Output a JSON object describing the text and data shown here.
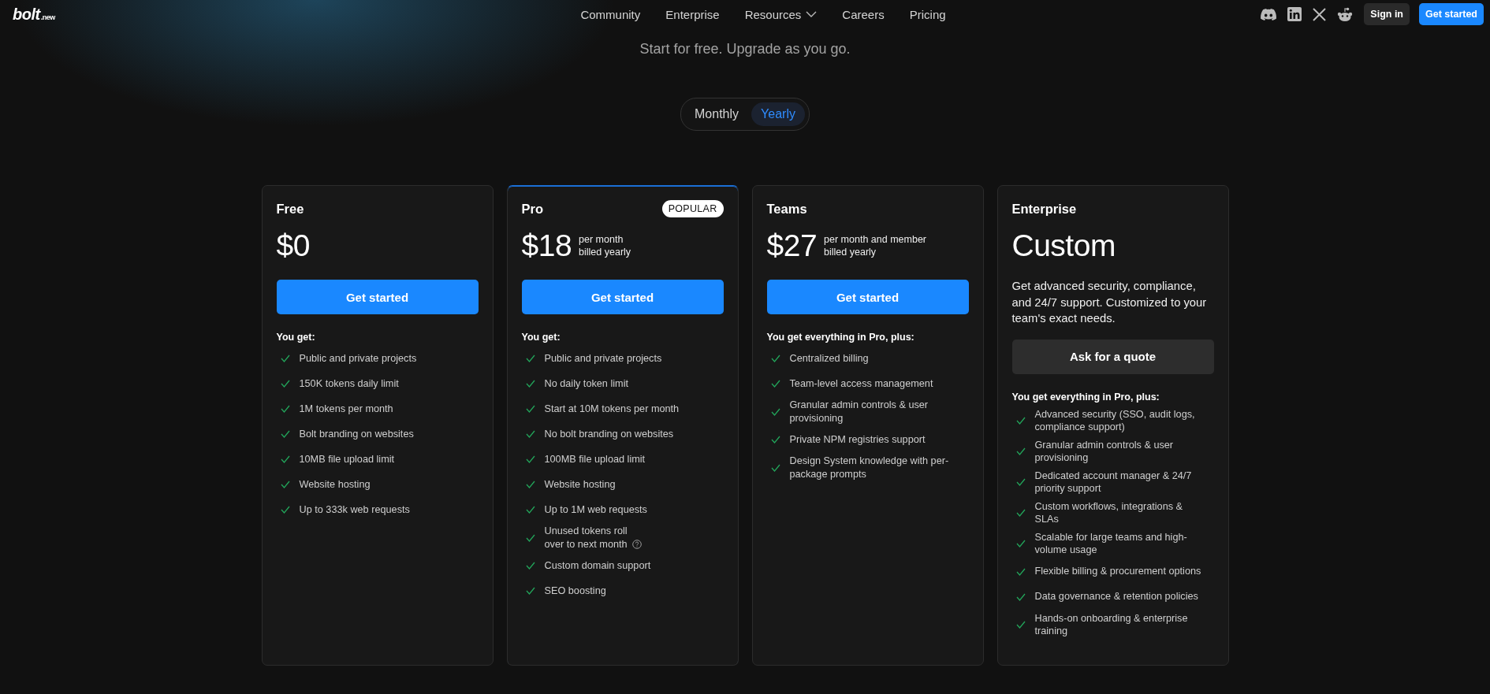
{
  "logo": {
    "name": "bolt",
    "suffix": ".new"
  },
  "nav": {
    "links": [
      {
        "label": "Community",
        "dropdown": false
      },
      {
        "label": "Enterprise",
        "dropdown": false
      },
      {
        "label": "Resources",
        "dropdown": true
      },
      {
        "label": "Careers",
        "dropdown": false
      },
      {
        "label": "Pricing",
        "dropdown": false
      }
    ],
    "socials": [
      {
        "kind": "discord"
      },
      {
        "kind": "linkedin"
      },
      {
        "kind": "x"
      },
      {
        "kind": "reddit"
      }
    ],
    "sign_in": "Sign in",
    "get_started": "Get started"
  },
  "subtitle": "Start for free. Upgrade as you go.",
  "billing_toggle": [
    {
      "label": "Monthly",
      "selected": false
    },
    {
      "label": "Yearly",
      "selected": true
    }
  ],
  "plans": [
    {
      "name": "Free",
      "price": "$0",
      "featured": false,
      "button": {
        "label": "Get started",
        "kind": "primary"
      },
      "features_heading": "You get:",
      "features": [
        {
          "text": "Public and private projects"
        },
        {
          "text": "150K tokens daily limit"
        },
        {
          "text": "1M tokens per month"
        },
        {
          "text": "Bolt branding on websites"
        },
        {
          "text": "10MB file upload limit"
        },
        {
          "text": "Website hosting"
        },
        {
          "text": "Up to 333k web requests"
        }
      ]
    },
    {
      "name": "Pro",
      "price": "$18",
      "price_note": [
        "per month",
        "billed yearly"
      ],
      "badge": "POPULAR",
      "featured": true,
      "button": {
        "label": "Get started",
        "kind": "primary"
      },
      "features_heading": "You get:",
      "features": [
        {
          "text": "Public and private projects",
          "help": false
        },
        {
          "text": "No daily token limit",
          "help": false
        },
        {
          "text": "Start at 10M tokens per month",
          "help": false
        },
        {
          "text": "No bolt branding on websites",
          "help": false
        },
        {
          "text": "100MB file upload limit",
          "help": false
        },
        {
          "text": "Website hosting",
          "help": false
        },
        {
          "text": "Up to 1M web requests",
          "help": false
        },
        {
          "text": "Unused tokens roll over to next month",
          "help": true
        },
        {
          "text": "Custom domain support",
          "help": false
        },
        {
          "text": "SEO boosting",
          "help": false
        }
      ]
    },
    {
      "name": "Teams",
      "price": "$27",
      "price_note": [
        "per month and member",
        "billed yearly"
      ],
      "featured": false,
      "button": {
        "label": "Get started",
        "kind": "primary"
      },
      "features_heading": "You get everything in Pro, plus:",
      "features": [
        {
          "text": "Centralized billing"
        },
        {
          "text": "Team-level access management"
        },
        {
          "text": "Granular admin controls & user provisioning"
        },
        {
          "text": "Private NPM registries support"
        },
        {
          "text": "Design System knowledge with per-package prompts"
        }
      ]
    },
    {
      "name": "Enterprise",
      "price": "Custom",
      "description": "Get advanced security, compliance, and 24/7 support. Customized to your team's exact needs.",
      "featured": false,
      "button": {
        "label": "Ask for a quote",
        "kind": "secondary"
      },
      "features_heading": "You get everything in Pro, plus:",
      "features": [
        {
          "text": "Advanced security (SSO, audit logs, compliance support)"
        },
        {
          "text": "Granular admin controls & user provisioning"
        },
        {
          "text": "Dedicated account manager & 24/7 priority support"
        },
        {
          "text": "Custom workflows, integrations & SLAs"
        },
        {
          "text": "Scalable for large teams and high-volume usage"
        },
        {
          "text": "Flexible billing & procurement options"
        },
        {
          "text": "Data governance & retention policies"
        },
        {
          "text": "Hands-on onboarding & enterprise training"
        }
      ]
    }
  ]
}
